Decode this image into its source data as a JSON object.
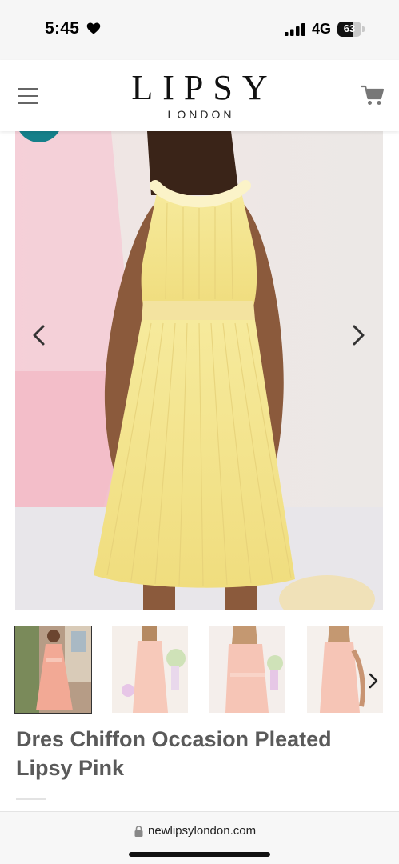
{
  "status_bar": {
    "time": "5:45",
    "network": "4G",
    "battery_level": "63",
    "battery_fraction": 0.63,
    "icons": [
      "heart-icon",
      "signal-icon",
      "battery-icon"
    ]
  },
  "header": {
    "logo_main": "LIPSY",
    "logo_sub": "LONDON",
    "icons": [
      "menu-icon",
      "cart-icon"
    ]
  },
  "product": {
    "title": "Dres Chiffon Occasion Pleated Lipsy Pink",
    "gallery": {
      "thumbnail_count": 4,
      "active_thumbnail": 1,
      "nav_icons": [
        "chevron-left-icon",
        "chevron-right-icon"
      ]
    }
  },
  "browser": {
    "url": "newlipsylondon.com"
  },
  "colors": {
    "badge": "#15808a",
    "dress_yellow": "#f3e48f",
    "dress_pink": "#f2b8a6",
    "title_text": "#5a5a5a"
  }
}
